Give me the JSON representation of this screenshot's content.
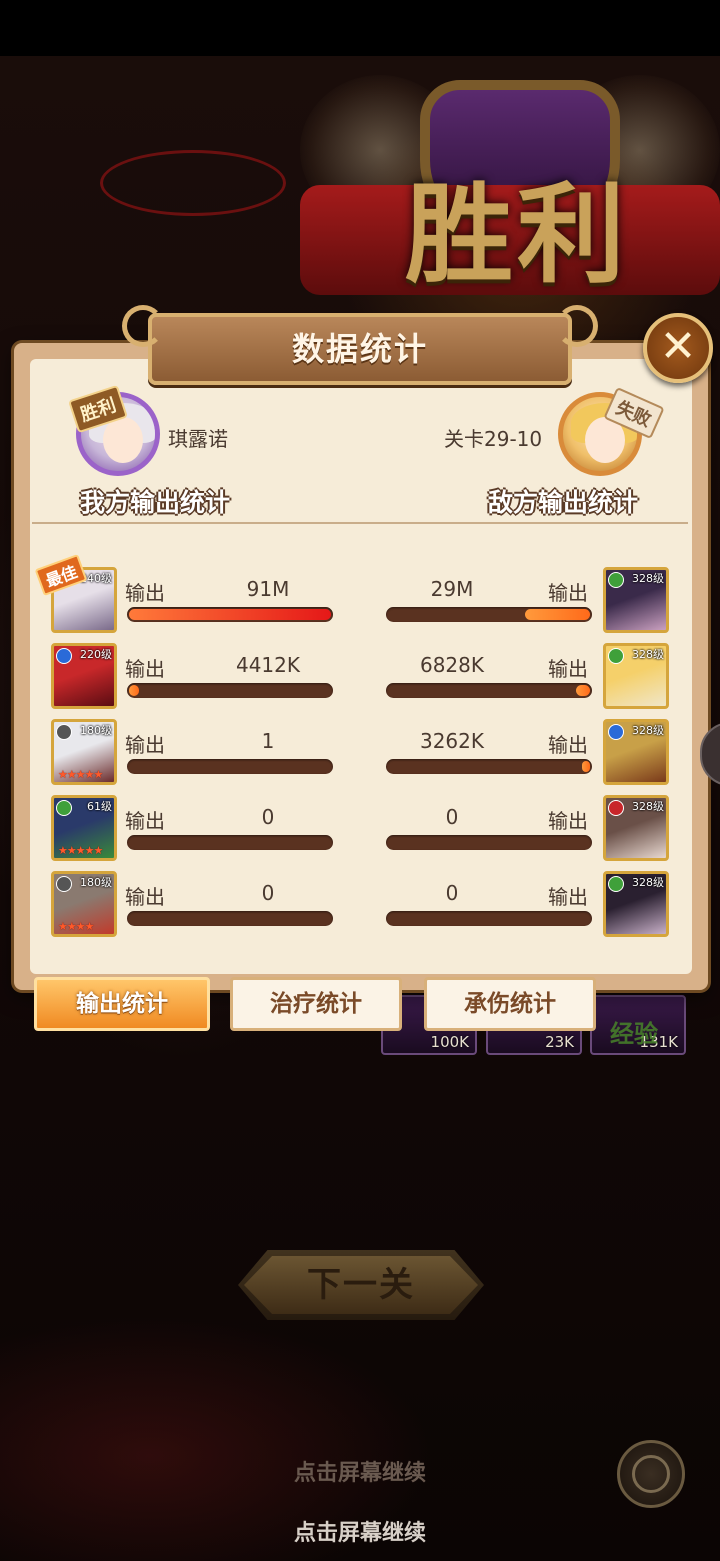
{
  "panel": {
    "title": "数据统计",
    "close_symbol": "✕"
  },
  "header": {
    "ally": {
      "result_tag": "胜利",
      "name": "琪露诺",
      "section_title": "我方输出统计"
    },
    "enemy": {
      "result_tag": "失败",
      "stage": "关卡29-10",
      "section_title": "敌方输出统计"
    }
  },
  "stat_label": "输出",
  "best_tag": "最佳",
  "rows": [
    {
      "ally": {
        "level": "240级",
        "value": "91M",
        "fill": 1.0,
        "best": true,
        "stars": "",
        "element_color": "#d5a53c"
      },
      "enemy": {
        "level": "328级",
        "value": "29M",
        "fill": 0.32,
        "stars": "",
        "element_color": "#3fa03a"
      }
    },
    {
      "ally": {
        "level": "220级",
        "value": "4412K",
        "fill": 0.05,
        "stars": "",
        "element_color": "#2a6ad8"
      },
      "enemy": {
        "level": "328级",
        "value": "6828K",
        "fill": 0.07,
        "stars": "",
        "element_color": "#3fa03a"
      }
    },
    {
      "ally": {
        "level": "180级",
        "value": "1",
        "fill": 0.0,
        "stars": "★★★★★",
        "element_color": "#555555"
      },
      "enemy": {
        "level": "328级",
        "value": "3262K",
        "fill": 0.035,
        "stars": "",
        "element_color": "#2a6ad8"
      }
    },
    {
      "ally": {
        "level": "61级",
        "value": "0",
        "fill": 0.0,
        "stars": "★★★★★",
        "element_color": "#3fa03a"
      },
      "enemy": {
        "level": "328级",
        "value": "0",
        "fill": 0.0,
        "stars": "",
        "element_color": "#c8262a"
      }
    },
    {
      "ally": {
        "level": "180级",
        "value": "0",
        "fill": 0.0,
        "stars": "★★★★",
        "element_color": "#555555"
      },
      "enemy": {
        "level": "328级",
        "value": "0",
        "fill": 0.0,
        "stars": "",
        "element_color": "#3fa03a"
      }
    }
  ],
  "tabs": [
    "输出统计",
    "治疗统计",
    "承伤统计"
  ],
  "rewards": {
    "values": [
      "100K",
      "23K",
      "131K"
    ],
    "last_label": "经验"
  },
  "victory_title": "胜利",
  "next_button": "下一关",
  "continue_hint": "点击屏幕继续",
  "colors": {
    "accent": "#f08a22",
    "best_bar": "#e51818",
    "bar_track": "#5a3220"
  }
}
